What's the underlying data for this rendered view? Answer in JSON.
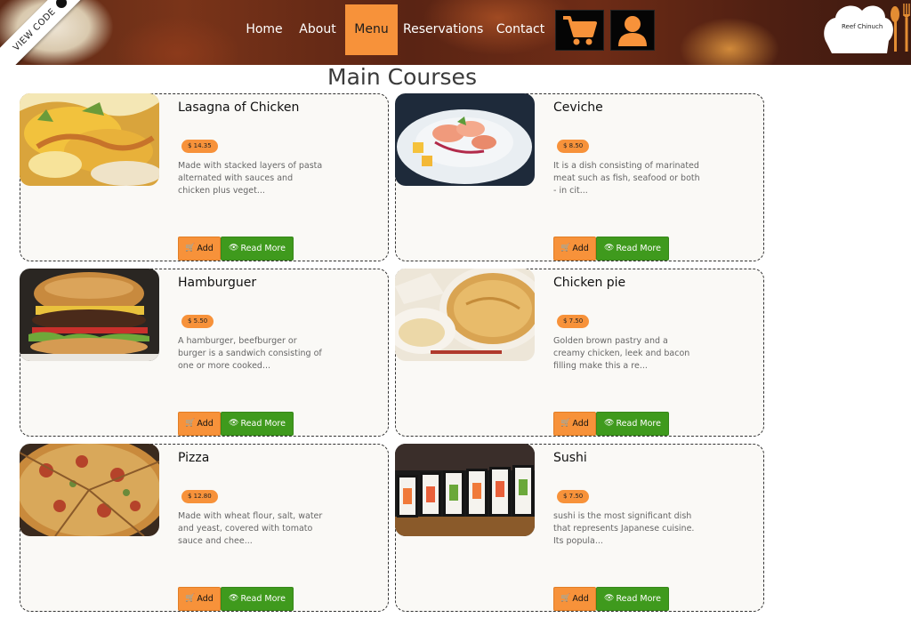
{
  "ribbon": {
    "label": "VIEW CODE"
  },
  "nav": {
    "items": [
      {
        "label": "Home",
        "active": false
      },
      {
        "label": "About",
        "active": false
      },
      {
        "label": "Menu",
        "active": true
      },
      {
        "label": "Reservations",
        "active": false
      },
      {
        "label": "Contact",
        "active": false
      }
    ],
    "cart_icon": "shopping-cart-icon",
    "user_icon": "user-icon"
  },
  "logo": {
    "text": "Reef Chinuch",
    "icon": "chef-hat-icon"
  },
  "page": {
    "title": "Main Courses"
  },
  "buttons": {
    "add_label": "Add",
    "read_more_label": "Read More"
  },
  "colors": {
    "accent": "#f7923a",
    "green": "#3f9a1d",
    "card_bg": "#faf9f6",
    "text_dark": "#111111",
    "text_muted": "#666666"
  },
  "dishes": [
    {
      "name": "Lasagna of Chicken",
      "price": "$ 14.35",
      "description": "Made with stacked layers of pasta alternated with sauces and chicken plus veget...",
      "image": "lasagna-photo"
    },
    {
      "name": "Ceviche",
      "price": "$ 8.50",
      "description": "It is a dish consisting of marinated meat such as fish, seafood or both - in cit...",
      "image": "ceviche-photo"
    },
    {
      "name": "Hamburguer",
      "price": "$ 5.50",
      "description": "A hamburger, beefburger or burger is a sandwich consisting of one or more cooked...",
      "image": "hamburger-photo"
    },
    {
      "name": "Chicken pie",
      "price": "$ 7.50",
      "description": "Golden brown pastry and a creamy chicken, leek and bacon filling make this a re...",
      "image": "chicken-pie-photo"
    },
    {
      "name": "Pizza",
      "price": "$ 12.80",
      "description": "Made with wheat flour, salt, water and yeast, covered with tomato sauce and chee...",
      "image": "pizza-photo"
    },
    {
      "name": "Sushi",
      "price": "$ 7.50",
      "description": "sushi is the most significant dish that represents Japanese cuisine. Its popula...",
      "image": "sushi-photo"
    }
  ]
}
